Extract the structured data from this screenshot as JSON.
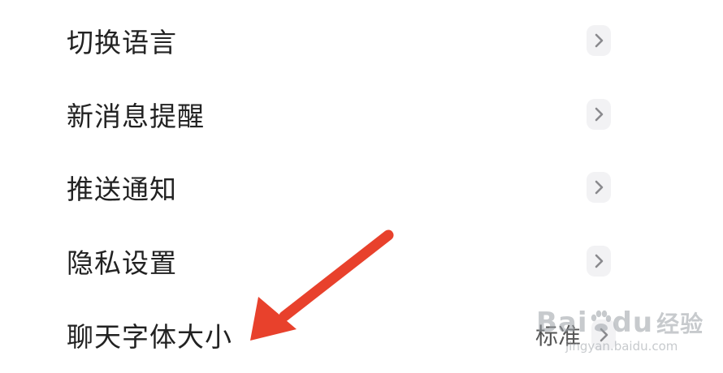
{
  "settings": {
    "items": [
      {
        "label": "切换语言",
        "value": ""
      },
      {
        "label": "新消息提醒",
        "value": ""
      },
      {
        "label": "推送通知",
        "value": ""
      },
      {
        "label": "隐私设置",
        "value": ""
      },
      {
        "label": "聊天字体大小",
        "value": "标准"
      }
    ]
  },
  "annotation": {
    "arrow_color": "#e8412c"
  },
  "watermark": {
    "brand_left": "Bai",
    "brand_right": "du",
    "suffix": "经验",
    "url": "jingyan.baidu.com"
  },
  "icons": {
    "row_chevron": "chevron-right-icon",
    "watermark_mark": "baidu-paw-icon"
  }
}
